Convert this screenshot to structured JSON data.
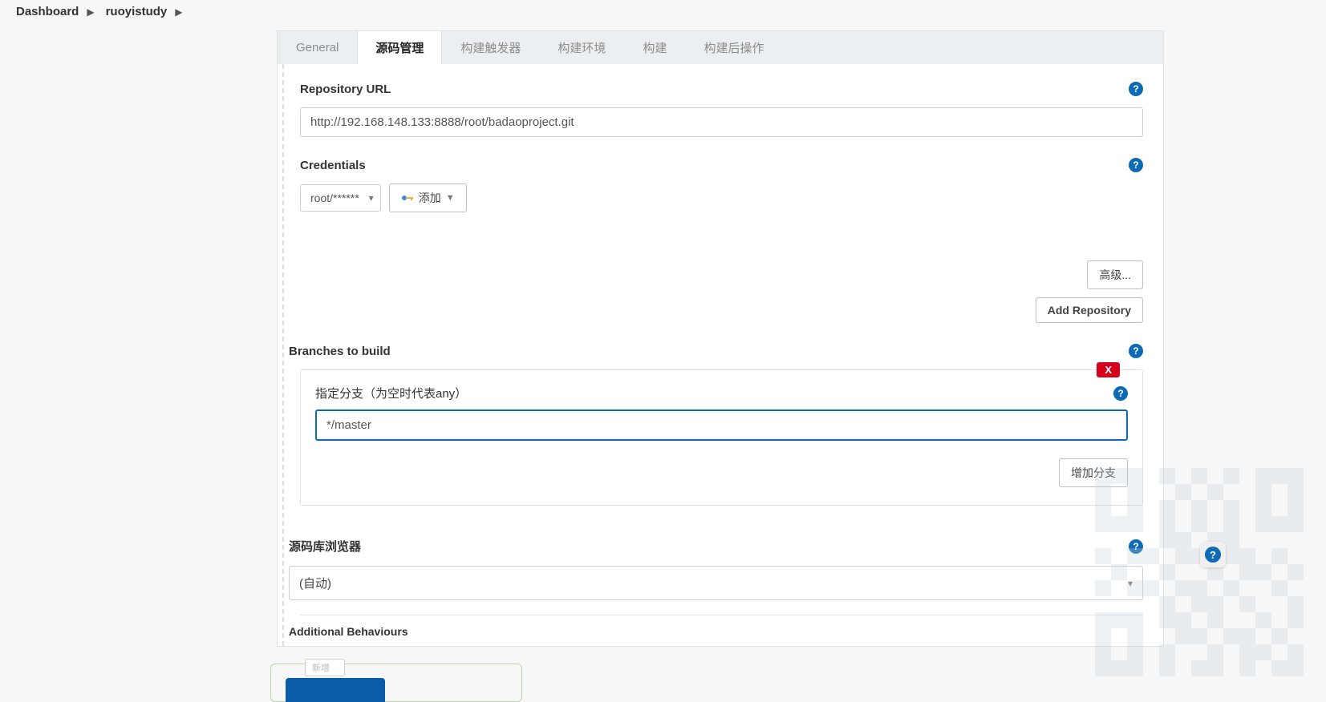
{
  "breadcrumbs": {
    "dashboard": "Dashboard",
    "job": "ruoyistudy"
  },
  "tabs": {
    "general": "General",
    "scm": "源码管理",
    "trigger": "构建触发器",
    "env": "构建环境",
    "build": "构建",
    "post": "构建后操作"
  },
  "repo": {
    "url_label": "Repository URL",
    "url_value": "http://192.168.148.133:8888/root/badaoproject.git",
    "cred_label": "Credentials",
    "cred_value": "root/******",
    "add_label": "添加",
    "advanced_label": "高级...",
    "add_repo_label": "Add Repository"
  },
  "branches": {
    "title": "Branches to build",
    "specifier_label": "指定分支（为空时代表any）",
    "value": "*/master",
    "delete": "X",
    "add_branch": "增加分支"
  },
  "browser": {
    "title": "源码库浏览器",
    "value": "(自动)"
  },
  "behaviours": {
    "title": "Additional Behaviours",
    "new": "新增"
  }
}
